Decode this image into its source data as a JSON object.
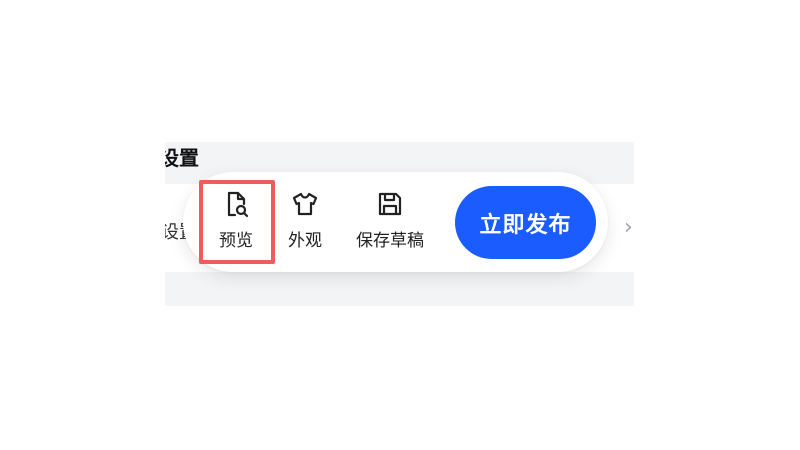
{
  "background": {
    "section_title": "设置",
    "row_label": "设置",
    "chevron": "›"
  },
  "toolbar": {
    "items": [
      {
        "label": "预览",
        "icon": "document-search-icon"
      },
      {
        "label": "外观",
        "icon": "tshirt-icon"
      },
      {
        "label": "保存草稿",
        "icon": "floppy-disk-icon"
      }
    ],
    "publish_label": "立即发布",
    "highlighted_item": "预览"
  },
  "colors": {
    "accent": "#1a5cff",
    "highlight_border": "#f05b5b",
    "panel_background": "#f3f4f6"
  }
}
